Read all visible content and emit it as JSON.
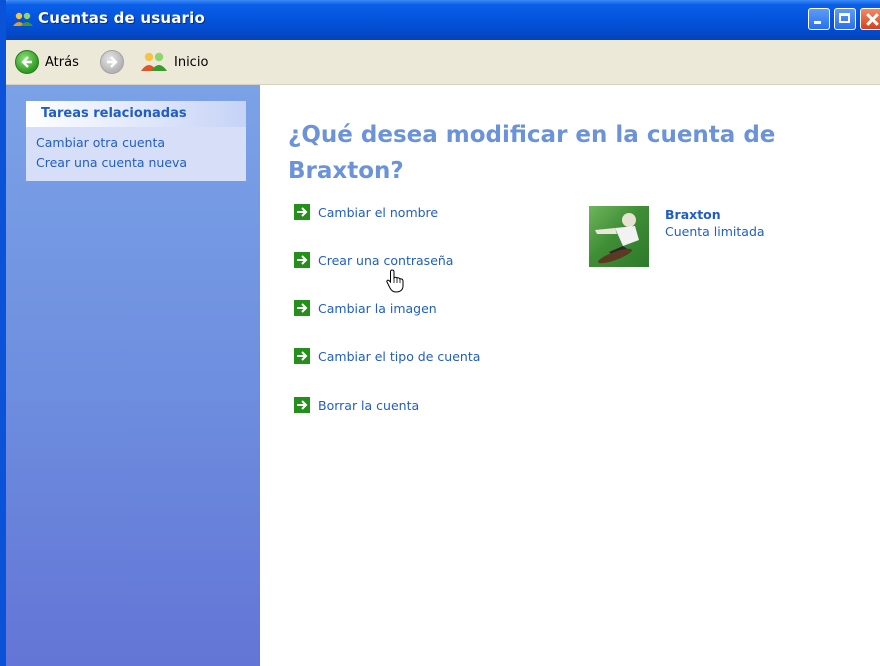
{
  "window": {
    "title": "Cuentas de usuario"
  },
  "toolbar": {
    "back_label": "Atrás",
    "home_label": "Inicio"
  },
  "sidebar": {
    "header": "Tareas relacionadas",
    "links": [
      {
        "label": "Cambiar otra cuenta"
      },
      {
        "label": "Crear una cuenta nueva"
      }
    ]
  },
  "main": {
    "question_line1": "¿Qué desea modificar en la cuenta de",
    "question_line2": "Braxton?",
    "actions": [
      {
        "label": "Cambiar el nombre"
      },
      {
        "label": "Crear una contraseña"
      },
      {
        "label": "Cambiar la imagen"
      },
      {
        "label": "Cambiar el tipo de cuenta"
      },
      {
        "label": "Borrar la cuenta"
      }
    ],
    "user": {
      "name": "Braxton",
      "account_type": "Cuenta limitada"
    }
  },
  "colors": {
    "title_bar": "#0453dc",
    "link": "#215dc6",
    "question": "#6c93d8",
    "action_icon": "#248f1a"
  }
}
